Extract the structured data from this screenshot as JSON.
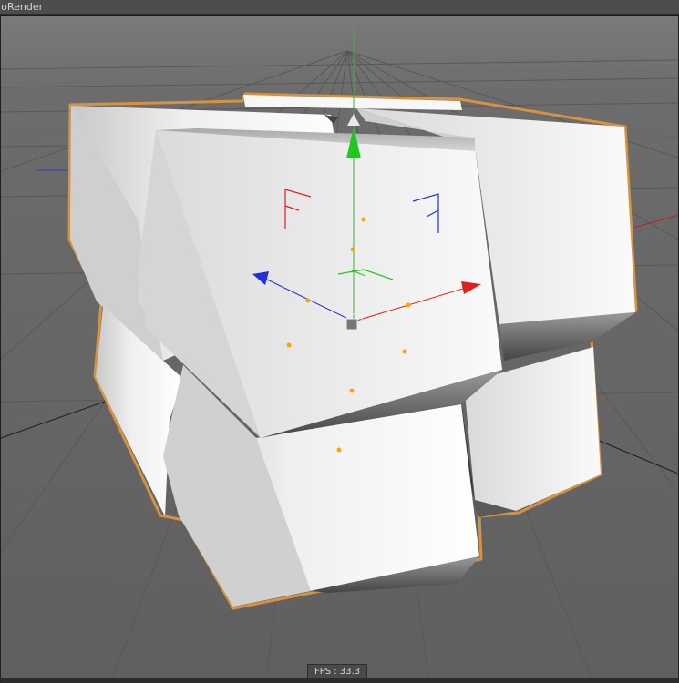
{
  "window": {
    "title": "roRender"
  },
  "viewport": {
    "fps_text": "FPS : 33.3",
    "background_color": "#6a6a6a",
    "grid_color": "#555555",
    "selection_outline_color": "#d7923f",
    "axis_colors": {
      "x": "#e02020",
      "y": "#1ec81e",
      "z": "#2030e0"
    },
    "handle_color": "#ffa500",
    "object_color": "#f2f2f2",
    "icons": [
      "move-gizmo-icon",
      "object-axis-icon",
      "rotation-handle-icon"
    ]
  }
}
